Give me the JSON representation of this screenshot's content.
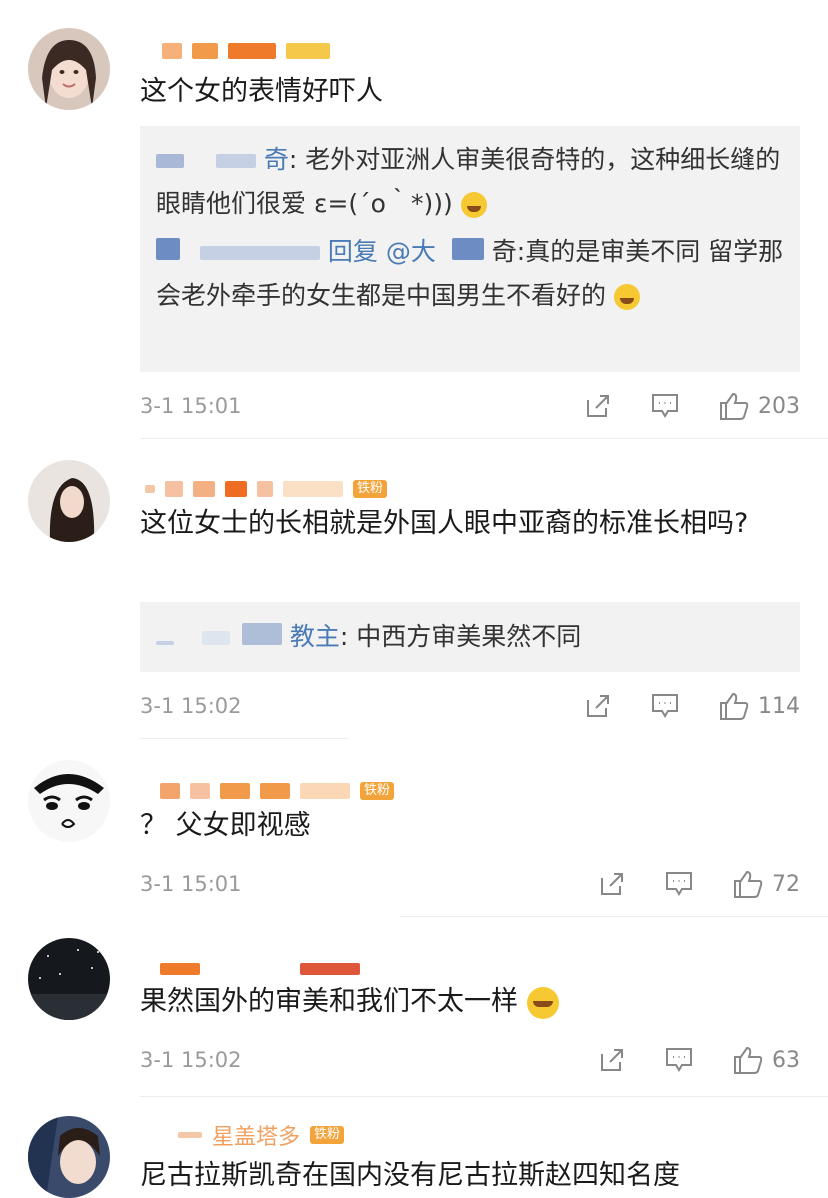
{
  "comments": [
    {
      "text": "这个女的表情好吓人",
      "replies": [
        {
          "author": "奇",
          "text": ": 老外对亚洲人审美很奇特的，这种细长缝的眼睛他们很爱 ε=(´ο｀*)))"
        },
        {
          "author": "回复 @大",
          "text": "奇:真的是审美不同 留学那会老外牵手的女生都是中国男生不看好的"
        }
      ],
      "time": "3-1 15:01",
      "likes": "203"
    },
    {
      "text": "这位女士的长相就是外国人眼中亚裔的标准长相吗?",
      "badge": "铁粉",
      "replies": [
        {
          "author": "教主",
          "text": ": 中西方审美果然不同"
        }
      ],
      "time": "3-1 15:02",
      "likes": "114"
    },
    {
      "text": "？ 父女即视感",
      "badge": "铁粉",
      "time": "3-1 15:01",
      "likes": "72"
    },
    {
      "text": "果然国外的审美和我们不太一样",
      "time": "3-1 15:02",
      "likes": "63"
    },
    {
      "text": "尼古拉斯凯奇在国内没有尼古拉斯赵四知名度",
      "name_fragment": "星盖塔多",
      "badge": "铁粉"
    }
  ],
  "colors": {
    "accent_name": "#f08a3a",
    "reply_author": "#4b7bb5",
    "meta_text": "#9a9a9a"
  },
  "icons": {
    "share": "share-icon",
    "comment": "comment-icon",
    "like": "thumbs-up-icon"
  }
}
